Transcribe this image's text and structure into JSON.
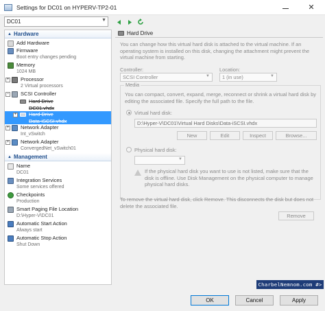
{
  "window": {
    "title": "Settings for DC01 on HYPERV-TP2-01",
    "close_glyph": "✕"
  },
  "vm_selector": {
    "value": "DC01"
  },
  "hardware_section": {
    "label": "Hardware"
  },
  "hardware_items": {
    "add_hardware": {
      "label": "Add Hardware"
    },
    "firmware": {
      "label": "Firmware",
      "sub": "Boot entry changes pending"
    },
    "memory": {
      "label": "Memory",
      "sub": "1024 MB"
    },
    "processor": {
      "label": "Processor",
      "sub": "2 Virtual processors"
    },
    "scsi": {
      "label": "SCSI Controller"
    },
    "hard_drive_1": {
      "label": "Hard Drive",
      "sub": "DC01.vhdx"
    },
    "hard_drive_2": {
      "label": "Hard Drive",
      "sub": "Data-iSCSI.vhdx"
    },
    "network_1": {
      "label": "Network Adapter",
      "sub": "Int_vSwitch"
    },
    "network_2": {
      "label": "Network Adapter",
      "sub": "ConvergedNet_vSwitch01"
    }
  },
  "management_section": {
    "label": "Management"
  },
  "management_items": {
    "name": {
      "label": "Name",
      "sub": "DC01"
    },
    "integration": {
      "label": "Integration Services",
      "sub": "Some services offered"
    },
    "checkpoints": {
      "label": "Checkpoints",
      "sub": "Production"
    },
    "paging": {
      "label": "Smart Paging File Location",
      "sub": "D:\\Hyper-V\\DC01"
    },
    "auto_start": {
      "label": "Automatic Start Action",
      "sub": "Always start"
    },
    "auto_stop": {
      "label": "Automatic Stop Action",
      "sub": "Shut Down"
    }
  },
  "panel": {
    "title": "Hard Drive",
    "description": "You can change how this virtual hard disk is attached to the virtual machine. If an operating system is installed on this disk, changing the attachment might prevent the virtual machine from starting.",
    "controller_label": "Controller:",
    "controller_value": "SCSI Controller",
    "location_label": "Location:",
    "location_value": "1 (in use)",
    "media_label": "Media",
    "media_desc": "You can compact, convert, expand, merge, reconnect or shrink a virtual hard disk by editing the associated file. Specify the full path to the file.",
    "vhd_label": "Virtual hard disk:",
    "vhd_path": "D:\\Hyper-V\\DC01\\Virtual Hard Disks\\Data-iSCSI.vhdx",
    "btn_new": "New",
    "btn_edit": "Edit",
    "btn_inspect": "Inspect",
    "btn_browse": "Browse...",
    "physical_label": "Physical hard disk:",
    "physical_note": "If the physical hard disk you want to use is not listed, make sure that the disk is offline. Use Disk Management on the physical computer to manage physical hard disks.",
    "remove_desc": "To remove the virtual hard disk, click Remove. This disconnects the disk but does not delete the associated file.",
    "btn_remove": "Remove"
  },
  "footer": {
    "ok": "OK",
    "cancel": "Cancel",
    "apply": "Apply"
  },
  "watermark": "CharbelNemnom.com #>",
  "colors": {
    "selection": "#3399ff",
    "section_header": "#1f4e8c",
    "nav_arrow": "#2ea043",
    "watermark_bg": "#1e3c78"
  }
}
